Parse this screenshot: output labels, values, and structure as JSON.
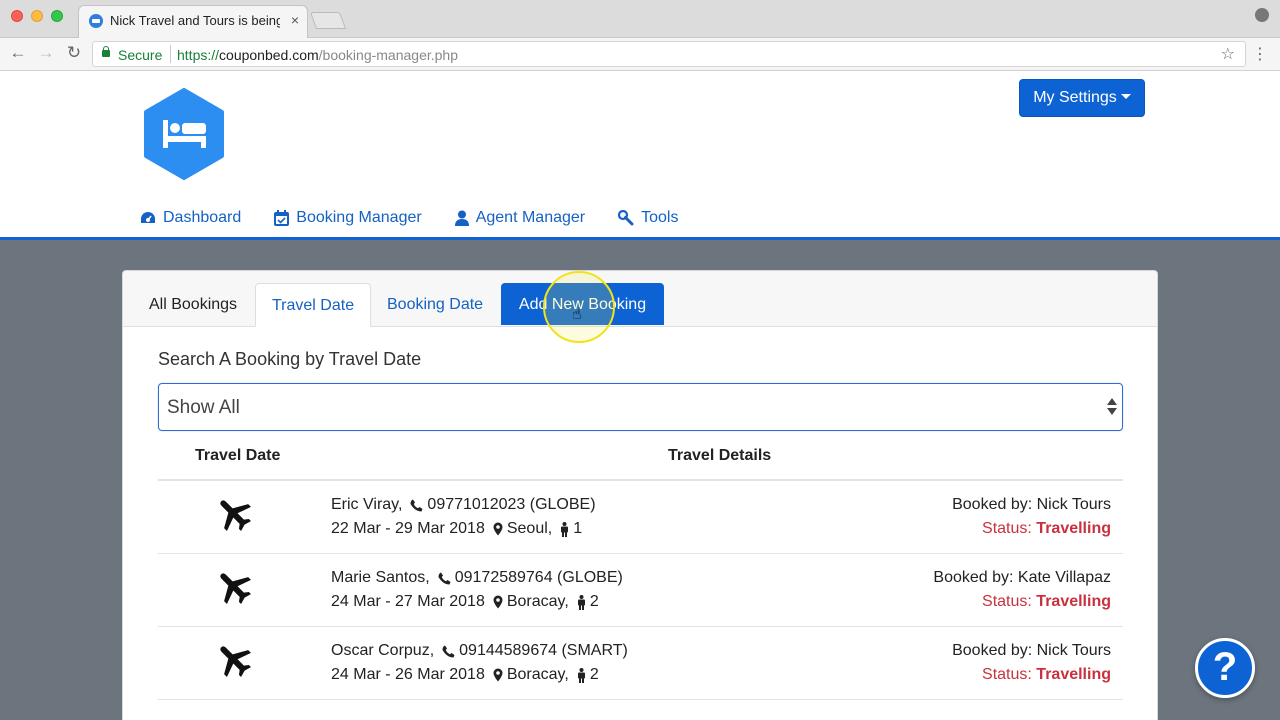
{
  "browser": {
    "tab_title": "Nick Travel and Tours is being",
    "tab_close": "×",
    "secure_label": "Secure",
    "url_scheme": "https://",
    "url_host": "couponbed.com",
    "url_path": "/booking-manager.php"
  },
  "header": {
    "settings_label": "My Settings",
    "nav": [
      {
        "label": "Dashboard",
        "icon": "dashboard-icon"
      },
      {
        "label": "Booking Manager",
        "icon": "calendar-check-icon"
      },
      {
        "label": "Agent Manager",
        "icon": "user-icon"
      },
      {
        "label": "Tools",
        "icon": "wrench-icon"
      }
    ],
    "accent_color": "#0d63d3"
  },
  "tabs": {
    "all": "All Bookings",
    "travel": "Travel Date",
    "booking": "Booking Date",
    "add": "Add New Booking"
  },
  "search": {
    "heading": "Search A Booking by Travel Date",
    "selected": "Show All"
  },
  "table": {
    "col_date": "Travel Date",
    "col_details": "Travel Details",
    "rows": [
      {
        "name": "Eric Viray,",
        "phone": "09771012023 (GLOBE)",
        "dates": "22 Mar - 29 Mar 2018",
        "place": "Seoul,",
        "pax": "1",
        "booked_by": "Booked by: Nick Tours",
        "status_label": "Status:",
        "status": "Travelling"
      },
      {
        "name": "Marie Santos,",
        "phone": "09172589764 (GLOBE)",
        "dates": "24 Mar - 27 Mar 2018",
        "place": "Boracay,",
        "pax": "2",
        "booked_by": "Booked by: Kate Villapaz",
        "status_label": "Status:",
        "status": "Travelling"
      },
      {
        "name": "Oscar Corpuz,",
        "phone": "09144589674 (SMART)",
        "dates": "24 Mar - 26 Mar 2018",
        "place": "Boracay,",
        "pax": "2",
        "booked_by": "Booked by: Nick Tours",
        "status_label": "Status:",
        "status": "Travelling"
      }
    ],
    "status_color": "#c8323e"
  },
  "help_label": "?"
}
